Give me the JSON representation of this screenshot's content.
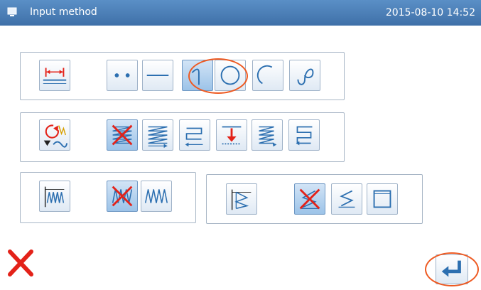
{
  "window": {
    "title": "Input method",
    "datetime": "2015-08-10 14:52",
    "title_icon": "monitor-icon"
  },
  "colors": {
    "titlebar": "#4a7db6",
    "icon_blue": "#2c6fb0",
    "highlight_red": "#e32219",
    "annotation_orange": "#ee5a22"
  },
  "groups": {
    "shape": {
      "header_icon": "dimension-measure-icon",
      "options": [
        {
          "icon": "point-icon",
          "selected": false
        },
        {
          "icon": "line-icon",
          "selected": false
        },
        {
          "icon": "arc-icon",
          "selected": true
        },
        {
          "icon": "circle-icon",
          "selected": false
        },
        {
          "icon": "curve-arc-icon",
          "selected": false
        },
        {
          "icon": "s-curve-icon",
          "selected": false
        }
      ]
    },
    "fill_pattern": {
      "header_icon": "rotate-pattern-icon",
      "options": [
        {
          "icon": "no-fill-icon",
          "selected": true
        },
        {
          "icon": "zigzag-fill-icon",
          "selected": false
        },
        {
          "icon": "back-fill-icon",
          "selected": false
        },
        {
          "icon": "down-arrow-fill-icon",
          "selected": false
        },
        {
          "icon": "diagonal-fill-icon",
          "selected": false
        },
        {
          "icon": "return-fill-icon",
          "selected": false
        }
      ]
    },
    "zigzag": {
      "header_icon": "zigzag-header-icon",
      "options": [
        {
          "icon": "no-zigzag-icon",
          "selected": true
        },
        {
          "icon": "zigzag-icon",
          "selected": false
        }
      ]
    },
    "edge": {
      "header_icon": "edge-header-icon",
      "options": [
        {
          "icon": "no-edge-icon",
          "selected": true
        },
        {
          "icon": "edge-zigzag-icon",
          "selected": false
        },
        {
          "icon": "square-edge-icon",
          "selected": false
        }
      ]
    }
  },
  "footer": {
    "cancel_icon": "close-icon",
    "confirm_icon": "enter-icon"
  }
}
